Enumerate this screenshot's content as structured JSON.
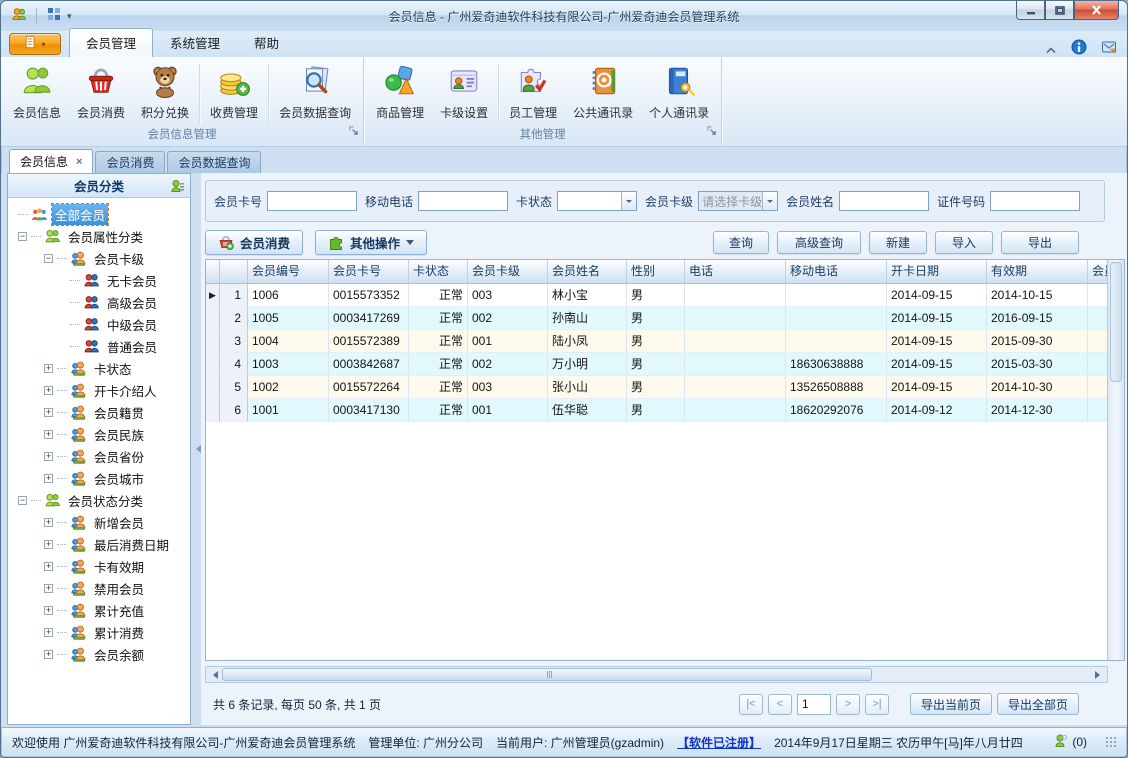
{
  "colors": {
    "accent_orange": "#f8a321",
    "titlebar_blue": "#bcd4ec",
    "grid_row_cyan": "#e1f8fc",
    "grid_row_cream": "#fdf9ec",
    "tree_selection_blue": "#3f92d8",
    "registered_link_blue": "#1133cc",
    "close_button_red": "#cf4a30"
  },
  "window": {
    "title": "会员信息 - 广州爱奇迪软件科技有限公司-广州爱奇迪会员管理系统",
    "quick_access_icons": [
      "app-logo-icon",
      "layout-grid-icon"
    ],
    "controls": [
      "minimize",
      "maximize",
      "close"
    ]
  },
  "ribbon": {
    "app_menu_icon": "menu-list-icon",
    "tabs": [
      {
        "label": "会员管理",
        "active": true
      },
      {
        "label": "系统管理",
        "active": false
      },
      {
        "label": "帮助",
        "active": false
      }
    ],
    "right_icons": [
      "collapse-ribbon-icon",
      "info-icon",
      "feedback-icon"
    ],
    "groups": [
      {
        "label": "会员信息管理",
        "buttons": [
          {
            "label": "会员信息",
            "icon": "members-icon"
          },
          {
            "label": "会员消费",
            "icon": "basket-icon"
          },
          {
            "label": "积分兑换",
            "icon": "teddy-bear-icon",
            "sep_after": true
          },
          {
            "label": "收费管理",
            "icon": "coins-icon",
            "sep_after": true
          },
          {
            "label": "会员数据查询",
            "icon": "doc-search-icon"
          }
        ]
      },
      {
        "label": "其他管理",
        "buttons": [
          {
            "label": "商品管理",
            "icon": "goods-icon"
          },
          {
            "label": "卡级设置",
            "icon": "card-level-icon",
            "sep_after": true
          },
          {
            "label": "员工管理",
            "icon": "staff-icon"
          },
          {
            "label": "公共通讯录",
            "icon": "public-contacts-icon"
          },
          {
            "label": "个人通讯录",
            "icon": "personal-contacts-icon"
          }
        ]
      }
    ]
  },
  "doc_tabs": [
    {
      "label": "会员信息",
      "active": true,
      "closable": true
    },
    {
      "label": "会员消费",
      "active": false
    },
    {
      "label": "会员数据查询",
      "active": false
    }
  ],
  "sidebar": {
    "title": "会员分类",
    "header_icon": "member-settings-icon",
    "tree": [
      {
        "label": "全部会员",
        "level": 0,
        "icon": "crowd-icon",
        "expander": "none",
        "selected": true
      },
      {
        "label": "会员属性分类",
        "level": 0,
        "icon": "group-green-icon",
        "expander": "minus"
      },
      {
        "label": "会员卡级",
        "level": 1,
        "icon": "group-orange-icon",
        "expander": "minus"
      },
      {
        "label": "无卡会员",
        "level": 2,
        "icon": "member-pair-icon",
        "expander": "none"
      },
      {
        "label": "高级会员",
        "level": 2,
        "icon": "member-pair-icon",
        "expander": "none"
      },
      {
        "label": "中级会员",
        "level": 2,
        "icon": "member-pair-icon",
        "expander": "none"
      },
      {
        "label": "普通会员",
        "level": 2,
        "icon": "member-pair-icon",
        "expander": "none"
      },
      {
        "label": "卡状态",
        "level": 1,
        "icon": "group-orange-icon",
        "expander": "plus"
      },
      {
        "label": "开卡介绍人",
        "level": 1,
        "icon": "group-orange-icon",
        "expander": "plus"
      },
      {
        "label": "会员籍贯",
        "level": 1,
        "icon": "group-orange-icon",
        "expander": "plus"
      },
      {
        "label": "会员民族",
        "level": 1,
        "icon": "group-orange-icon",
        "expander": "plus"
      },
      {
        "label": "会员省份",
        "level": 1,
        "icon": "group-orange-icon",
        "expander": "plus"
      },
      {
        "label": "会员城市",
        "level": 1,
        "icon": "group-orange-icon",
        "expander": "plus"
      },
      {
        "label": "会员状态分类",
        "level": 0,
        "icon": "group-green-icon",
        "expander": "minus"
      },
      {
        "label": "新增会员",
        "level": 1,
        "icon": "group-orange-icon",
        "expander": "plus"
      },
      {
        "label": "最后消费日期",
        "level": 1,
        "icon": "group-orange-icon",
        "expander": "plus"
      },
      {
        "label": "卡有效期",
        "level": 1,
        "icon": "group-orange-icon",
        "expander": "plus"
      },
      {
        "label": "禁用会员",
        "level": 1,
        "icon": "group-orange-icon",
        "expander": "plus"
      },
      {
        "label": "累计充值",
        "level": 1,
        "icon": "group-orange-icon",
        "expander": "plus"
      },
      {
        "label": "累计消费",
        "level": 1,
        "icon": "group-orange-icon",
        "expander": "plus"
      },
      {
        "label": "会员余额",
        "level": 1,
        "icon": "group-orange-icon",
        "expander": "plus"
      }
    ]
  },
  "search": {
    "fields": [
      {
        "label": "会员卡号",
        "type": "input",
        "value": ""
      },
      {
        "label": "移动电话",
        "type": "input",
        "value": ""
      },
      {
        "label": "卡状态",
        "type": "combo",
        "value": "",
        "muted": false
      },
      {
        "label": "会员卡级",
        "type": "combo",
        "value": "请选择卡级",
        "muted": true
      },
      {
        "label": "会员姓名",
        "type": "input",
        "value": ""
      },
      {
        "label": "证件号码",
        "type": "input",
        "value": ""
      }
    ]
  },
  "toolbar": {
    "left": [
      {
        "label": "会员消费",
        "icon": "basket-add-icon",
        "dropdown": false
      },
      {
        "label": "其他操作",
        "icon": "puzzle-icon",
        "dropdown": true
      }
    ],
    "right": [
      {
        "label": "查询"
      },
      {
        "label": "高级查询"
      },
      {
        "label": "新建"
      },
      {
        "label": "导入"
      },
      {
        "label": "导出"
      }
    ]
  },
  "grid": {
    "columns": [
      "会员编号",
      "会员卡号",
      "卡状态",
      "会员卡级",
      "会员姓名",
      "性别",
      "电话",
      "移动电话",
      "开卡日期",
      "有效期",
      "会员"
    ],
    "rows": [
      {
        "num": "1",
        "selected": true,
        "cells": [
          "1006",
          "0015573352",
          "正常",
          "003",
          "林小宝",
          "男",
          "",
          "",
          "2014-09-15",
          "2014-10-15",
          ""
        ]
      },
      {
        "num": "2",
        "selected": false,
        "cells": [
          "1005",
          "0003417269",
          "正常",
          "002",
          "孙南山",
          "男",
          "",
          "",
          "2014-09-15",
          "2016-09-15",
          ""
        ]
      },
      {
        "num": "3",
        "selected": false,
        "cells": [
          "1004",
          "0015572389",
          "正常",
          "001",
          "陆小凤",
          "男",
          "",
          "",
          "2014-09-15",
          "2015-09-30",
          ""
        ]
      },
      {
        "num": "4",
        "selected": false,
        "cells": [
          "1003",
          "0003842687",
          "正常",
          "002",
          "万小明",
          "男",
          "",
          "18630638888",
          "2014-09-15",
          "2015-03-30",
          ""
        ]
      },
      {
        "num": "5",
        "selected": false,
        "cells": [
          "1002",
          "0015572264",
          "正常",
          "003",
          "张小山",
          "男",
          "",
          "13526508888",
          "2014-09-15",
          "2014-10-30",
          ""
        ]
      },
      {
        "num": "6",
        "selected": false,
        "cells": [
          "1001",
          "0003417130",
          "正常",
          "001",
          "伍华聪",
          "男",
          "",
          "18620292076",
          "2014-09-12",
          "2014-12-30",
          ""
        ]
      }
    ]
  },
  "pager": {
    "summary": "共 6 条记录, 每页 50 条, 共 1 页",
    "nav": {
      "first": "|<",
      "prev": "<",
      "page": "1",
      "next": ">",
      "last": ">|"
    },
    "export_current": "导出当前页",
    "export_all": "导出全部页"
  },
  "statusbar": {
    "welcome": "欢迎使用 广州爱奇迪软件科技有限公司-广州爱奇迪会员管理系统",
    "org": "管理单位: 广州分公司",
    "user": "当前用户: 广州管理员(gzadmin)",
    "registered": "【软件已注册】",
    "date": "2014年9月17日星期三 农历甲午[马]年八月廿四",
    "online_icon": "person-icon",
    "online_count": "(0)"
  }
}
